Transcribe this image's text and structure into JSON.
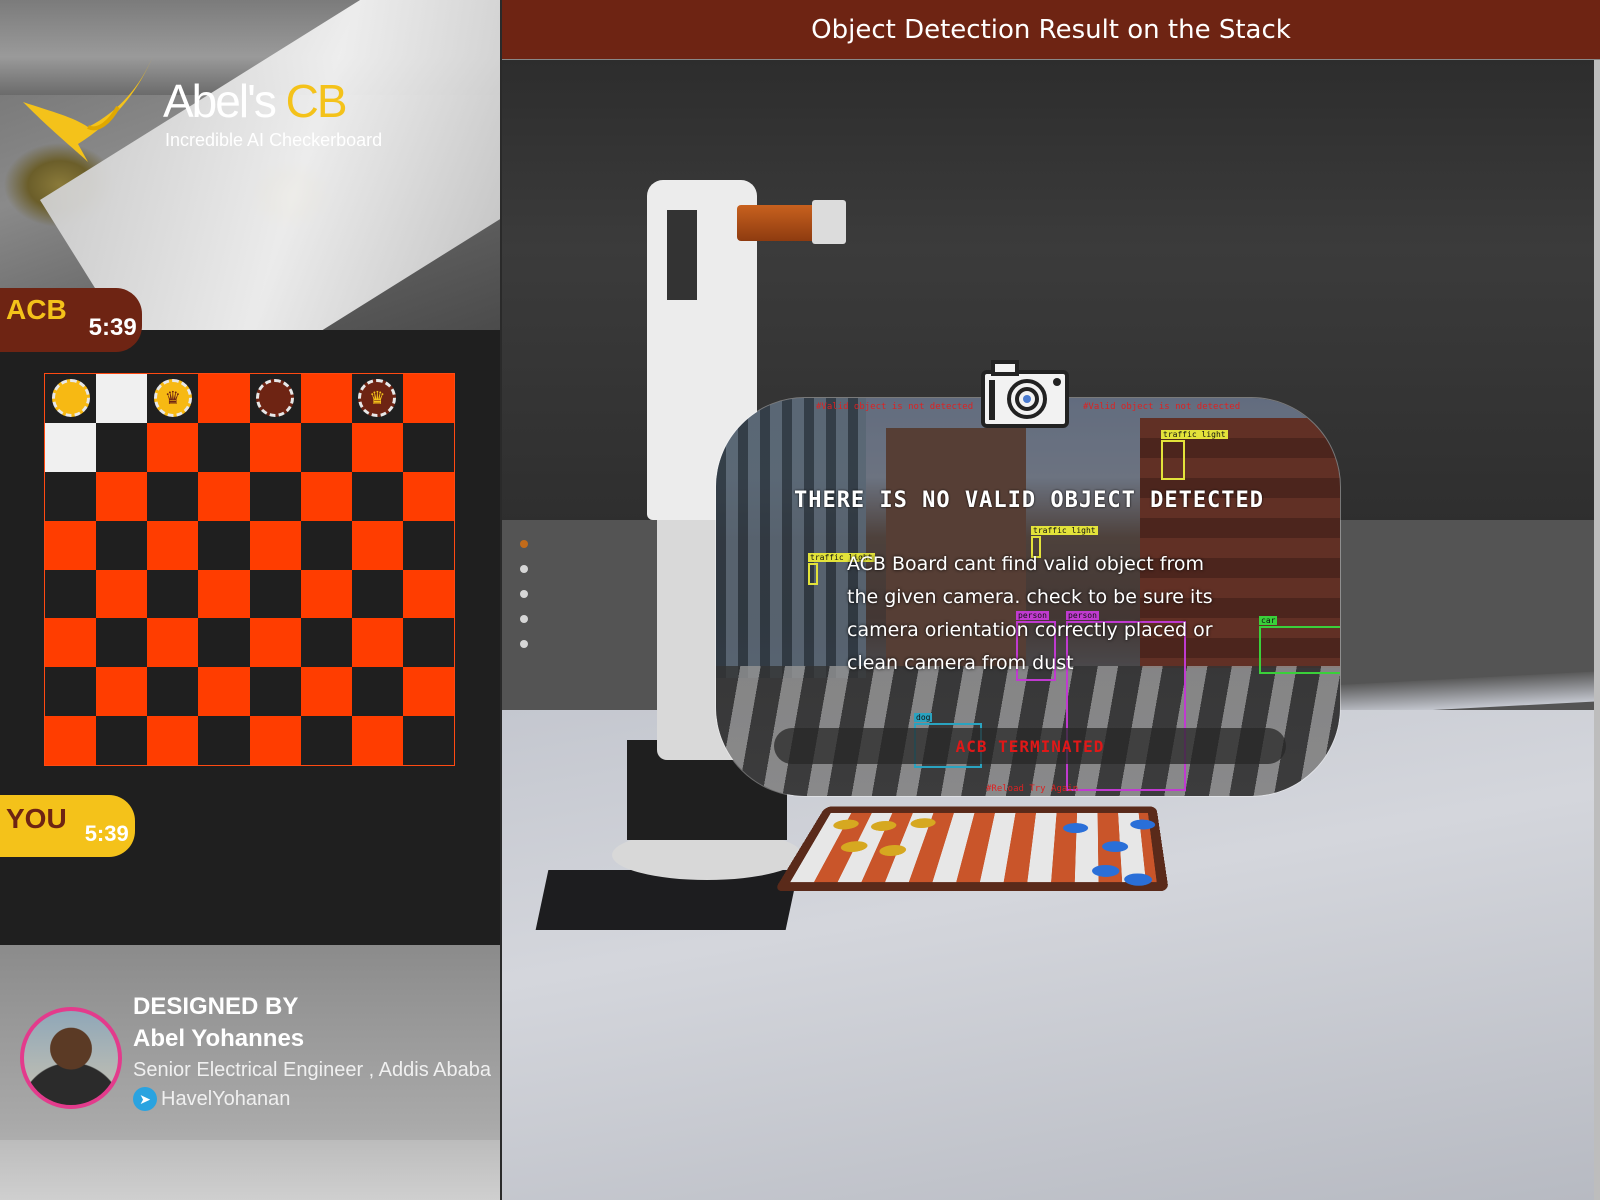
{
  "logo": {
    "name_main": "Abel's",
    "name_accent": "CB",
    "tagline": "Incredible AI Checkerboard"
  },
  "timers": {
    "opponent": {
      "label": "ACB",
      "time": "5:39"
    },
    "player": {
      "label": "YOU",
      "time": "5:39"
    }
  },
  "board": {
    "size": 8,
    "pieces": [
      {
        "row": 0,
        "col": 0,
        "color": "yellow",
        "king": false
      },
      {
        "row": 0,
        "col": 2,
        "color": "yellow",
        "king": true
      },
      {
        "row": 0,
        "col": 4,
        "color": "brown",
        "king": false
      },
      {
        "row": 0,
        "col": 6,
        "color": "brown",
        "king": true
      }
    ]
  },
  "designer": {
    "heading": "DESIGNED BY",
    "name": "Abel Yohannes",
    "role": "Senior Electrical Engineer , Addis Ababa",
    "telegram": "HavelYohanan"
  },
  "header": {
    "title": "Object Detection Result on the Stack"
  },
  "carousel": {
    "count": 5,
    "active": 0
  },
  "dialog": {
    "title": "THERE IS NO VALID OBJECT DETECTED",
    "message": "ACB Board cant find valid object from the given camera. check to be sure its camera orientation correctly placed or clean camera from dust",
    "status": "ACB TERMINATED",
    "warning_left": "#Valid object is not detected",
    "warning_right": "#Valid object is not detected",
    "bottom_hint": "#Reload Try Again",
    "detections": [
      "traffic light",
      "traffic light",
      "traffic light",
      "person",
      "person",
      "car",
      "dog"
    ]
  },
  "colors": {
    "brand_brown": "#6e2413",
    "brand_yellow": "#f4c21a",
    "board_red": "#ff3d00",
    "danger": "#e01818"
  },
  "icons": {
    "camera": "camera-icon",
    "telegram": "telegram-icon",
    "crown": "crown-icon"
  }
}
